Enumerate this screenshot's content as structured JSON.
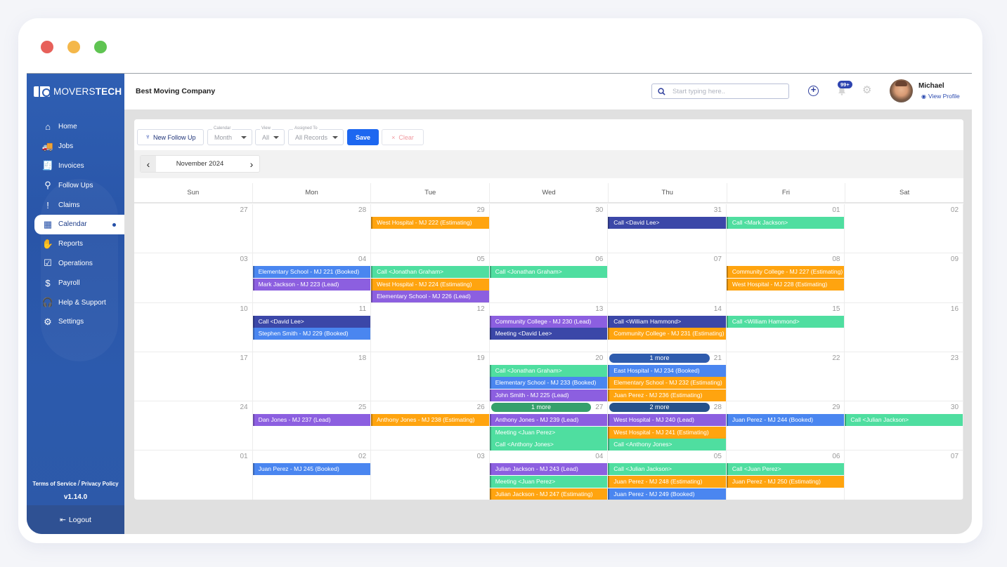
{
  "window": {
    "dots": [
      "#e7605a",
      "#f4b74a",
      "#5fc452"
    ]
  },
  "brand": {
    "name_light": "MOVERS",
    "name_bold": "TECH"
  },
  "sidebar": {
    "items": [
      {
        "label": "Home",
        "icon": "home-truck-icon",
        "glyph": "⌂"
      },
      {
        "label": "Jobs",
        "icon": "truck-icon",
        "glyph": "🚚"
      },
      {
        "label": "Invoices",
        "icon": "invoice-icon",
        "glyph": "🧾"
      },
      {
        "label": "Follow Ups",
        "icon": "follow-up-icon",
        "glyph": "⚲"
      },
      {
        "label": "Claims",
        "icon": "exclamation-icon",
        "glyph": "!"
      },
      {
        "label": "Calendar",
        "icon": "calendar-icon",
        "glyph": "▦",
        "active": true
      },
      {
        "label": "Reports",
        "icon": "hand-icon",
        "glyph": "✋"
      },
      {
        "label": "Operations",
        "icon": "clipboard-check-icon",
        "glyph": "☑"
      },
      {
        "label": "Payroll",
        "icon": "payroll-icon",
        "glyph": "$"
      },
      {
        "label": "Help & Support",
        "icon": "headset-icon",
        "glyph": "🎧"
      },
      {
        "label": "Settings",
        "icon": "gear-icon",
        "glyph": "⚙"
      }
    ],
    "terms": "Terms of Service",
    "privacy": "Privacy Policy",
    "version": "v1.14.0",
    "logout": "Logout"
  },
  "header": {
    "company": "Best Moving Company",
    "search_placeholder": "Start typing here..",
    "notification_count": "99+",
    "user_name": "Michael",
    "view_profile": "View Profile"
  },
  "toolbar": {
    "new_follow_up": "New Follow Up",
    "calendar_label": "Calendar",
    "calendar_value": "Month",
    "view_label": "View",
    "view_value": "All",
    "assigned_label": "Assigned To",
    "assigned_value": "All Records",
    "save": "Save",
    "clear": "Clear"
  },
  "calendar": {
    "month_label": "November 2024",
    "weekdays": [
      "Sun",
      "Mon",
      "Tue",
      "Wed",
      "Thu",
      "Fri",
      "Sat"
    ],
    "colors": {
      "estimating": "#ffa40f",
      "booked": "#4a86f0",
      "lead": "#8c5fe0",
      "call_dark": "#3b47a8",
      "call_green": "#4fdea0",
      "more_blue": "#2f5cad",
      "more_green": "#36a06c",
      "more_navy": "#26528a"
    },
    "weeks": [
      {
        "days": [
          "27",
          "28",
          "29",
          "30",
          "31",
          "01",
          "02"
        ],
        "events": [
          {
            "day": 2,
            "row": 0,
            "text": "West Hospital - MJ 222 (Estimating)",
            "color": "estimating"
          },
          {
            "day": 4,
            "row": 0,
            "text": "Call <David Lee>",
            "color": "call_dark"
          },
          {
            "day": 5,
            "row": 0,
            "text": "Call <Mark Jackson>",
            "color": "call_green"
          }
        ],
        "more": []
      },
      {
        "days": [
          "03",
          "04",
          "05",
          "06",
          "07",
          "08",
          "09"
        ],
        "events": [
          {
            "day": 1,
            "row": 0,
            "text": "Elementary School - MJ 221 (Booked)",
            "color": "booked"
          },
          {
            "day": 1,
            "row": 1,
            "text": "Mark Jackson - MJ 223 (Lead)",
            "color": "lead"
          },
          {
            "day": 2,
            "row": 0,
            "text": "Call <Jonathan Graham>",
            "color": "call_green"
          },
          {
            "day": 2,
            "row": 1,
            "text": "West Hospital - MJ 224 (Estimating)",
            "color": "estimating"
          },
          {
            "day": 2,
            "row": 2,
            "text": "Elementary School - MJ 226 (Lead)",
            "color": "lead"
          },
          {
            "day": 3,
            "row": 0,
            "text": "Call <Jonathan Graham>",
            "color": "call_green"
          },
          {
            "day": 5,
            "row": 0,
            "text": "Community College - MJ 227 (Estimating)",
            "color": "estimating"
          },
          {
            "day": 5,
            "row": 1,
            "text": "West Hospital - MJ 228 (Estimating)",
            "color": "estimating"
          }
        ],
        "more": []
      },
      {
        "days": [
          "10",
          "11",
          "12",
          "13",
          "14",
          "15",
          "16"
        ],
        "events": [
          {
            "day": 1,
            "row": 0,
            "text": "Call <David Lee>",
            "color": "call_dark"
          },
          {
            "day": 1,
            "row": 1,
            "text": "Stephen Smith - MJ 229 (Booked)",
            "color": "booked"
          },
          {
            "day": 3,
            "row": 0,
            "text": "Community College - MJ 230 (Lead)",
            "color": "lead"
          },
          {
            "day": 3,
            "row": 1,
            "text": "Meeting <David Lee>",
            "color": "call_dark"
          },
          {
            "day": 4,
            "row": 0,
            "text": "Call <William Hammond>",
            "color": "call_dark"
          },
          {
            "day": 4,
            "row": 1,
            "text": "Community College - MJ 231 (Estimating)",
            "color": "estimating"
          },
          {
            "day": 5,
            "row": 0,
            "text": "Call <William Hammond>",
            "color": "call_green"
          }
        ],
        "more": []
      },
      {
        "days": [
          "17",
          "18",
          "19",
          "20",
          "21",
          "22",
          "23"
        ],
        "events": [
          {
            "day": 3,
            "row": 0,
            "text": "Call <Jonathan Graham>",
            "color": "call_green"
          },
          {
            "day": 3,
            "row": 1,
            "text": "Elementary School - MJ 233 (Booked)",
            "color": "booked"
          },
          {
            "day": 3,
            "row": 2,
            "text": "John Smith - MJ 225 (Lead)",
            "color": "lead"
          },
          {
            "day": 4,
            "row": 0,
            "text": "East Hospital - MJ 234 (Booked)",
            "color": "booked"
          },
          {
            "day": 4,
            "row": 1,
            "text": "Elementary School - MJ 232 (Estimating)",
            "color": "estimating"
          },
          {
            "day": 4,
            "row": 2,
            "text": "Juan Perez - MJ 236 (Estimating)",
            "color": "estimating"
          }
        ],
        "more": [
          {
            "day": 4,
            "text": "1 more",
            "color": "more_blue"
          }
        ]
      },
      {
        "days": [
          "24",
          "25",
          "26",
          "27",
          "28",
          "29",
          "30"
        ],
        "events": [
          {
            "day": 1,
            "row": 0,
            "text": "Dan Jones - MJ 237 (Lead)",
            "color": "lead"
          },
          {
            "day": 2,
            "row": 0,
            "text": "Anthony Jones - MJ 238 (Estimating)",
            "color": "estimating"
          },
          {
            "day": 3,
            "row": 0,
            "text": "Anthony Jones - MJ 239 (Lead)",
            "color": "lead"
          },
          {
            "day": 3,
            "row": 1,
            "text": "Meeting <Juan Perez>",
            "color": "call_green"
          },
          {
            "day": 3,
            "row": 2,
            "text": "Call <Anthony Jones>",
            "color": "call_green"
          },
          {
            "day": 4,
            "row": 0,
            "text": "West Hospital - MJ 240 (Lead)",
            "color": "lead"
          },
          {
            "day": 4,
            "row": 1,
            "text": "West Hospital - MJ 241 (Estimating)",
            "color": "estimating"
          },
          {
            "day": 4,
            "row": 2,
            "text": "Call <Anthony Jones>",
            "color": "call_green"
          },
          {
            "day": 5,
            "row": 0,
            "text": "Juan Perez - MJ 244 (Booked)",
            "color": "booked"
          },
          {
            "day": 6,
            "row": 0,
            "text": "Call <Julian Jackson>",
            "color": "call_green"
          }
        ],
        "more": [
          {
            "day": 3,
            "text": "1 more",
            "color": "more_green"
          },
          {
            "day": 4,
            "text": "2 more",
            "color": "more_navy"
          }
        ]
      },
      {
        "days": [
          "01",
          "02",
          "03",
          "04",
          "05",
          "06",
          "07"
        ],
        "events": [
          {
            "day": 1,
            "row": 0,
            "text": "Juan Perez - MJ 245 (Booked)",
            "color": "booked"
          },
          {
            "day": 3,
            "row": 0,
            "text": "Julian Jackson - MJ 243 (Lead)",
            "color": "lead"
          },
          {
            "day": 3,
            "row": 1,
            "text": "Meeting <Juan Perez>",
            "color": "call_green"
          },
          {
            "day": 3,
            "row": 2,
            "text": "Julian Jackson - MJ 247 (Estimating)",
            "color": "estimating"
          },
          {
            "day": 4,
            "row": 0,
            "text": "Call <Julian Jackson>",
            "color": "call_green"
          },
          {
            "day": 4,
            "row": 1,
            "text": "Juan Perez - MJ 248 (Estimating)",
            "color": "estimating"
          },
          {
            "day": 4,
            "row": 2,
            "text": "Juan Perez - MJ 249 (Booked)",
            "color": "booked"
          },
          {
            "day": 5,
            "row": 0,
            "text": "Call <Juan Perez>",
            "color": "call_green"
          },
          {
            "day": 5,
            "row": 1,
            "text": "Juan Perez - MJ 250 (Estimating)",
            "color": "estimating"
          }
        ],
        "more": []
      }
    ]
  }
}
